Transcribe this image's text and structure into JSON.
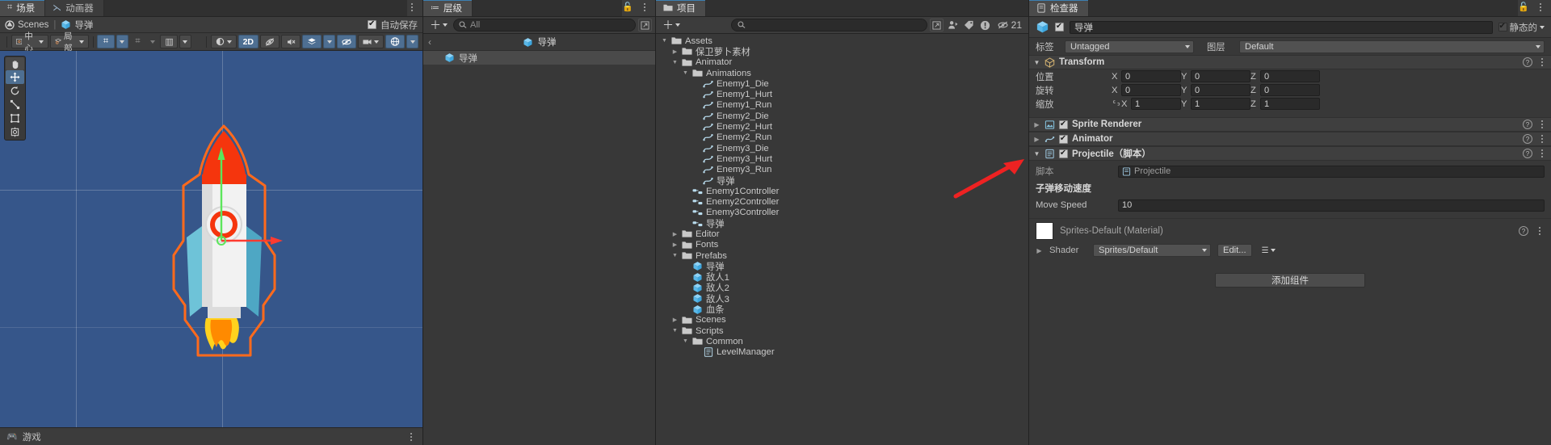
{
  "scene": {
    "tabs": [
      {
        "label": "场景",
        "icon": "grid-icon",
        "active": true
      },
      {
        "label": "动画器",
        "icon": "animator-icon",
        "active": false
      }
    ],
    "breadcrumb": {
      "root": "Scenes",
      "divider": "|",
      "current": "导弹"
    },
    "autosave": {
      "label": "自动保存",
      "checked": true
    },
    "tools": {
      "pivot": "中心",
      "space": "局部",
      "mode_2d": "2D",
      "grid_label": "",
      "snap_label": ""
    },
    "left_tools": [
      "hand-tool",
      "move-tool",
      "rotate-tool",
      "scale-tool",
      "rect-tool",
      "transform-tool"
    ],
    "game_tab": {
      "label": "游戏",
      "icon": "gamepad-icon"
    }
  },
  "hierarchy": {
    "tab_label": "层级",
    "search_placeholder": "All",
    "header_object": "导弹",
    "items": [
      {
        "label": "导弹",
        "selected": true
      }
    ]
  },
  "project": {
    "tab_label": "项目",
    "search_placeholder": "",
    "warning_count": "21",
    "tree": [
      {
        "label": "Assets",
        "depth": 0,
        "icon": "folder-open-icon",
        "twist": "down"
      },
      {
        "label": "保卫萝卜素材",
        "depth": 1,
        "icon": "folder-icon",
        "twist": "right"
      },
      {
        "label": "Animator",
        "depth": 1,
        "icon": "folder-open-icon",
        "twist": "down"
      },
      {
        "label": "Animations",
        "depth": 2,
        "icon": "folder-open-icon",
        "twist": "down"
      },
      {
        "label": "Enemy1_Die",
        "depth": 3,
        "icon": "anim-clip-icon",
        "twist": ""
      },
      {
        "label": "Enemy1_Hurt",
        "depth": 3,
        "icon": "anim-clip-icon",
        "twist": ""
      },
      {
        "label": "Enemy1_Run",
        "depth": 3,
        "icon": "anim-clip-icon",
        "twist": ""
      },
      {
        "label": "Enemy2_Die",
        "depth": 3,
        "icon": "anim-clip-icon",
        "twist": ""
      },
      {
        "label": "Enemy2_Hurt",
        "depth": 3,
        "icon": "anim-clip-icon",
        "twist": ""
      },
      {
        "label": "Enemy2_Run",
        "depth": 3,
        "icon": "anim-clip-icon",
        "twist": ""
      },
      {
        "label": "Enemy3_Die",
        "depth": 3,
        "icon": "anim-clip-icon",
        "twist": ""
      },
      {
        "label": "Enemy3_Hurt",
        "depth": 3,
        "icon": "anim-clip-icon",
        "twist": ""
      },
      {
        "label": "Enemy3_Run",
        "depth": 3,
        "icon": "anim-clip-icon",
        "twist": ""
      },
      {
        "label": "导弹",
        "depth": 3,
        "icon": "anim-clip-icon",
        "twist": ""
      },
      {
        "label": "Enemy1Controller",
        "depth": 2,
        "icon": "controller-icon",
        "twist": ""
      },
      {
        "label": "Enemy2Controller",
        "depth": 2,
        "icon": "controller-icon",
        "twist": ""
      },
      {
        "label": "Enemy3Controller",
        "depth": 2,
        "icon": "controller-icon",
        "twist": ""
      },
      {
        "label": "导弹",
        "depth": 2,
        "icon": "controller-icon",
        "twist": ""
      },
      {
        "label": "Editor",
        "depth": 1,
        "icon": "folder-icon",
        "twist": "right"
      },
      {
        "label": "Fonts",
        "depth": 1,
        "icon": "folder-icon",
        "twist": "right"
      },
      {
        "label": "Prefabs",
        "depth": 1,
        "icon": "folder-open-icon",
        "twist": "down"
      },
      {
        "label": "导弹",
        "depth": 2,
        "icon": "prefab-icon",
        "twist": ""
      },
      {
        "label": "敌人1",
        "depth": 2,
        "icon": "prefab-icon",
        "twist": ""
      },
      {
        "label": "敌人2",
        "depth": 2,
        "icon": "prefab-icon",
        "twist": ""
      },
      {
        "label": "敌人3",
        "depth": 2,
        "icon": "prefab-icon",
        "twist": ""
      },
      {
        "label": "血条",
        "depth": 2,
        "icon": "prefab-icon",
        "twist": ""
      },
      {
        "label": "Scenes",
        "depth": 1,
        "icon": "folder-icon",
        "twist": "right"
      },
      {
        "label": "Scripts",
        "depth": 1,
        "icon": "folder-open-icon",
        "twist": "down"
      },
      {
        "label": "Common",
        "depth": 2,
        "icon": "folder-open-icon",
        "twist": "down"
      },
      {
        "label": "LevelManager",
        "depth": 3,
        "icon": "script-icon",
        "twist": ""
      }
    ]
  },
  "inspector": {
    "tab_label": "检查器",
    "object_name": "导弹",
    "object_enabled": true,
    "static_label": "静态的",
    "tag": {
      "label": "标签",
      "value": "Untagged"
    },
    "layer": {
      "label": "图层",
      "value": "Default"
    },
    "transform": {
      "title": "Transform",
      "position": {
        "label": "位置",
        "x": "0",
        "y": "0",
        "z": "0"
      },
      "rotation": {
        "label": "旋转",
        "x": "0",
        "y": "0",
        "z": "0"
      },
      "scale": {
        "label": "缩放",
        "x": "1",
        "y": "1",
        "z": "1"
      },
      "axis_labels": {
        "x": "X",
        "y": "Y",
        "z": "Z"
      }
    },
    "components": [
      {
        "name": "Sprite Renderer",
        "enabled": true,
        "expanded": false
      },
      {
        "name": "Animator",
        "enabled": true,
        "expanded": false
      },
      {
        "name": "Projectile（脚本）",
        "enabled": true,
        "expanded": true
      }
    ],
    "projectile": {
      "script_label": "脚本",
      "script_value": "Projectile",
      "section_header": "子弹移动速度",
      "move_speed_label": "Move Speed",
      "move_speed_value": "10"
    },
    "material": {
      "name": "Sprites-Default (Material)",
      "shader_label": "Shader",
      "shader_value": "Sprites/Default",
      "edit_label": "Edit..."
    },
    "add_component_label": "添加组件"
  },
  "colors": {
    "accent_blue": "#4e6f92",
    "panel_bg": "#383838",
    "scene_bg": "#36568a",
    "arrow_red": "#ee2222"
  }
}
